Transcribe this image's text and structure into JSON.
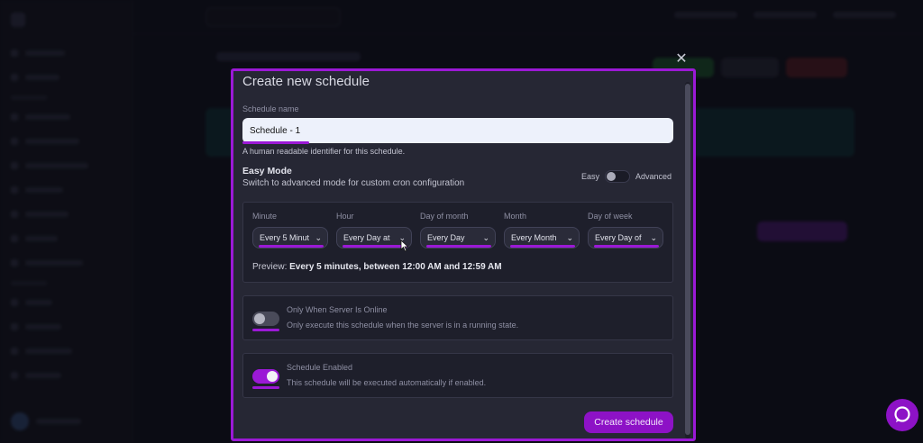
{
  "modal": {
    "title": "Create new schedule",
    "close_icon": "close-icon",
    "schedule_name": {
      "label": "Schedule name",
      "value": "Schedule - 1",
      "helper": "A human readable identifier for this schedule."
    },
    "easy_mode": {
      "title": "Easy Mode",
      "subtitle": "Switch to advanced mode for custom cron configuration",
      "left_label": "Easy",
      "right_label": "Advanced"
    },
    "cron": {
      "fields": [
        {
          "label": "Minute",
          "value": "Every 5 Minut"
        },
        {
          "label": "Hour",
          "value": "Every Day at"
        },
        {
          "label": "Day of month",
          "value": "Every Day"
        },
        {
          "label": "Month",
          "value": "Every Month"
        },
        {
          "label": "Day of week",
          "value": "Every Day of"
        }
      ],
      "preview_label": "Preview:",
      "preview_value": "Every 5 minutes, between 12:00 AM and 12:59 AM"
    },
    "options": [
      {
        "title": "Only When Server Is Online",
        "description": "Only execute this schedule when the server is in a running state.",
        "enabled": false
      },
      {
        "title": "Schedule Enabled",
        "description": "This schedule will be executed automatically if enabled.",
        "enabled": true
      }
    ],
    "submit_label": "Create schedule"
  },
  "colors": {
    "accent": "#9b19d6",
    "button": "#8d12c6",
    "modal_bg": "#262734",
    "page_bg": "#0e0f1a"
  }
}
